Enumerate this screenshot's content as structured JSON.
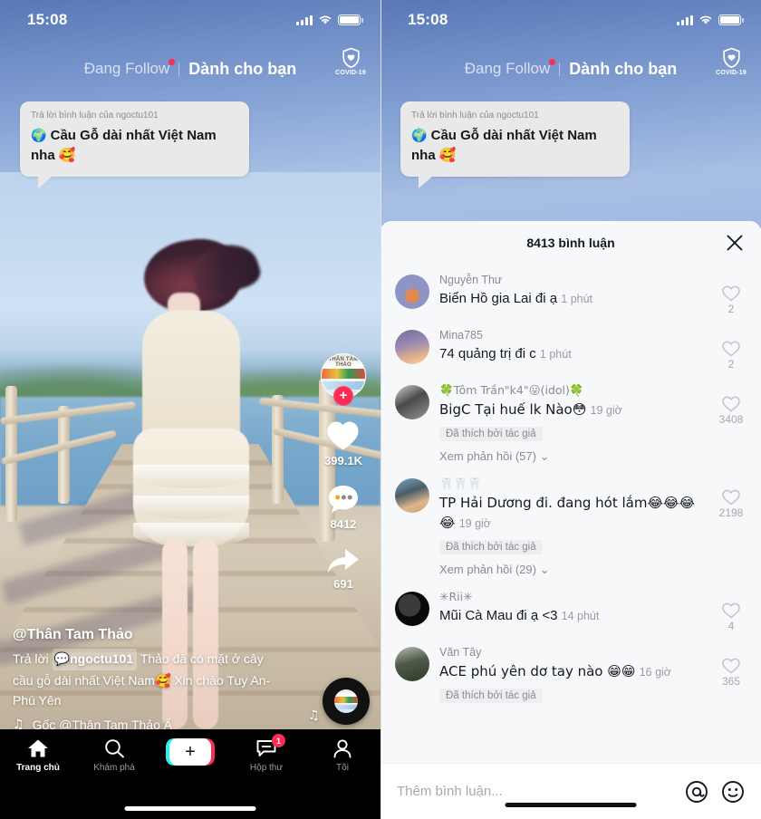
{
  "status_bar": {
    "time": "15:08",
    "signal_icon": "signal-bars-icon",
    "wifi_icon": "wifi-icon",
    "battery_icon": "battery-icon"
  },
  "top_nav": {
    "following_tab": "Đang Follow",
    "foryou_tab": "Dành cho bạn",
    "covid_label": "COVID-19",
    "covid_icon": "shield-heart-icon"
  },
  "reply_bubble": {
    "sub": "Trả lời bình luận của ngoctu101",
    "icon": "globe-icon",
    "text": "Cầu Gỗ dài nhất Việt Nam nha 🥰"
  },
  "video_rail": {
    "avatar_text": "THÂN TÂM THẢO",
    "follow_label": "+",
    "like_icon": "heart-icon",
    "like_count": "399.1K",
    "comment_icon": "comment-bubble-icon",
    "comment_count": "8412",
    "share_icon": "share-arrow-icon",
    "share_count": "691",
    "disc_icon": "music-disc-icon",
    "note_icon": "music-note-icon"
  },
  "caption": {
    "username": "@Thân Tam Thảo",
    "reply_word": "Trả lời",
    "mention": "ngoctu101",
    "mention_icon": "comment-icon",
    "body_line1": "Thảo đã có mặt ở cây",
    "body_line2": "cầu gỗ dài nhất Việt Nam🥰 Xin chào",
    "body_line3": "Tuy An- Phú Yên",
    "music_icon": "music-note-icon",
    "music_text": "Gốc    @Thân Tam Thảo Ấ"
  },
  "tab_bar": {
    "items": [
      {
        "label": "Trang chủ",
        "icon": "home-icon",
        "active": true
      },
      {
        "label": "Khám phá",
        "icon": "search-icon",
        "active": false
      },
      {
        "label": "",
        "icon": "create-plus-icon",
        "active": false
      },
      {
        "label": "Hộp thư",
        "icon": "inbox-icon",
        "badge": "1",
        "active": false
      },
      {
        "label": "Tôi",
        "icon": "profile-icon",
        "active": false
      }
    ]
  },
  "comments_sheet": {
    "title": "8413 bình luận",
    "close_icon": "close-icon",
    "input_placeholder": "Thêm bình luận...",
    "mention_icon": "at-sign-icon",
    "emoji_icon": "smiley-face-icon",
    "liked_badge": "Đã thích bởi tác giả",
    "items": [
      {
        "name": "Nguyễn Thư",
        "text": "Biển Hồ gia Lai đi ạ",
        "time": "1 phút",
        "likes": "2",
        "liked_by_author": false,
        "replies": null
      },
      {
        "name": "Mina785",
        "text": "74 quảng trị đi c",
        "time": "1 phút",
        "likes": "2",
        "liked_by_author": false,
        "replies": null
      },
      {
        "name": "🍀Tôm Trần\"k4\"😛(idol)🍀",
        "text": "BigC Tại huế lk Nào😳",
        "time": "19 giờ",
        "likes": "3408",
        "liked_by_author": true,
        "replies": "Xem phản hồi (57)"
      },
      {
        "name": "🦷🦷🦷",
        "text": "TP Hải Dương đi. đang hót lắm😂😂😂😂",
        "time": "19 giờ",
        "likes": "2198",
        "liked_by_author": true,
        "replies": "Xem phản hồi (29)"
      },
      {
        "name": "✳Rii✳",
        "text": "Mũi Cà Mau đi ạ <3",
        "time": "14 phút",
        "likes": "4",
        "liked_by_author": false,
        "replies": null
      },
      {
        "name": "Văn Tây",
        "text": "ACE phú yên dơ tay nào 😁😁",
        "time": "16 giờ",
        "likes": "365",
        "liked_by_author": true,
        "replies": null
      }
    ]
  },
  "colors": {
    "accent_pink": "#fe2c55",
    "accent_cyan": "#25f4ee",
    "sheet_bg": "#f7f8fa",
    "text_primary": "#161823",
    "text_secondary": "#8a8b91"
  }
}
